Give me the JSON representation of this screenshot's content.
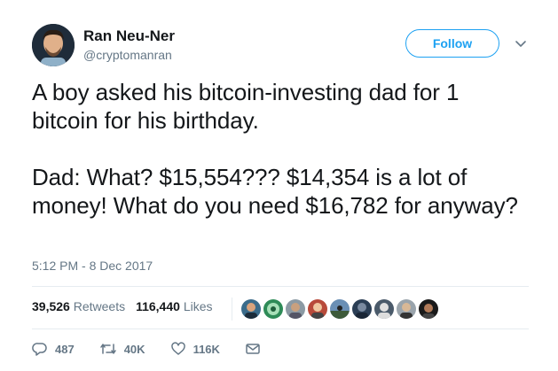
{
  "author": {
    "name": "Ran Neu-Ner",
    "handle": "@cryptomanran"
  },
  "follow_label": "Follow",
  "tweet": {
    "paragraphs": [
      "A boy asked his bitcoin-investing dad for 1 bitcoin for his birthday.",
      "Dad: What? $15,554??? $14,354 is a lot of money! What do you need $16,782 for anyway?"
    ],
    "timestamp": "5:12 PM - 8 Dec 2017"
  },
  "stats": {
    "retweets_count": "39,526",
    "retweets_label": "Retweets",
    "likes_count": "116,440",
    "likes_label": "Likes"
  },
  "actions": {
    "replies": "487",
    "retweets": "40K",
    "likes": "116K"
  },
  "colors": {
    "accent": "#1da1f2",
    "secondary_text": "#657786",
    "divider": "#e6ecf0"
  },
  "icons": [
    "chevron-down-icon",
    "reply-icon",
    "retweet-icon",
    "heart-icon",
    "message-icon"
  ]
}
